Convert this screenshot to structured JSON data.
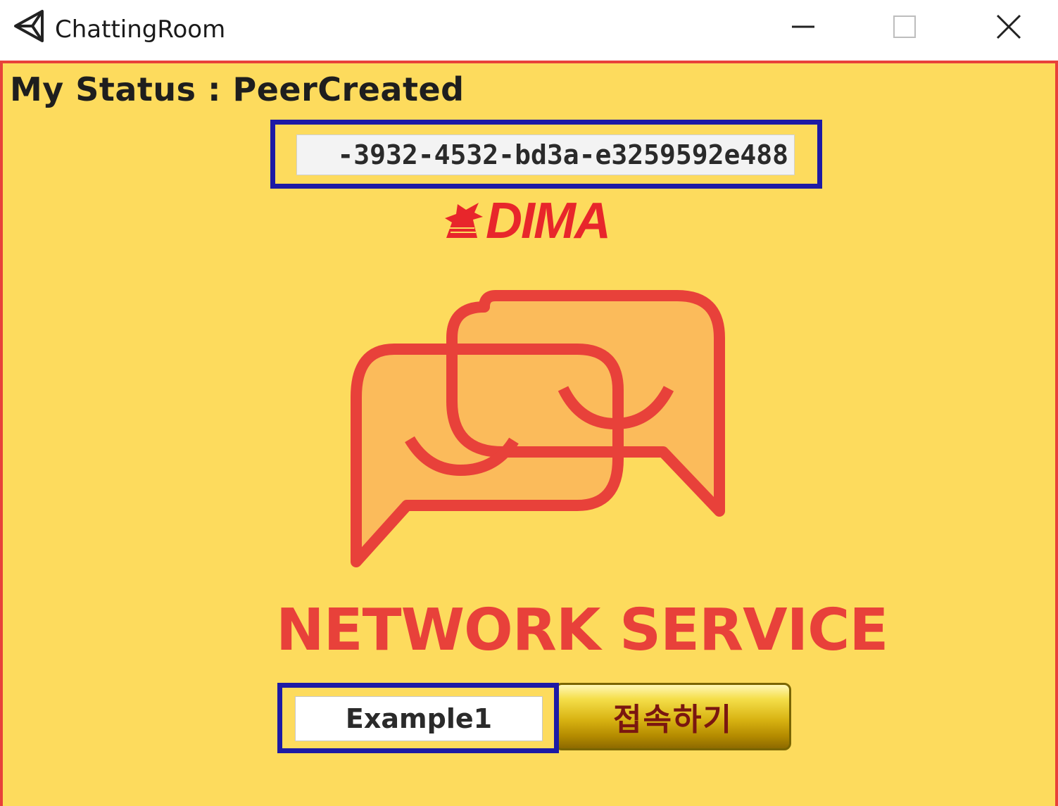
{
  "window": {
    "title": "ChattingRoom",
    "app_icon": "unity-logo-icon",
    "controls": [
      "minimize-icon",
      "maximize-icon",
      "close-icon"
    ]
  },
  "status": {
    "text": "My Status : PeerCreated"
  },
  "peer_id_field": {
    "value": "-3932-4532-bd3a-e3259592e488"
  },
  "logo": {
    "text": "DIMA",
    "icon": "dragon-head-icon"
  },
  "illustration": {
    "icon": "chat-bubbles-icon"
  },
  "service_title": "NETWORK SERVICE",
  "name_field": {
    "value": "Example1"
  },
  "connect_button": {
    "label": "접속하기"
  },
  "colors": {
    "background": "#fddb5d",
    "border": "#e8413a",
    "highlight_frame": "#1d1aa5",
    "logo": "#e8262b",
    "bubble_fill": "#fbbb5b",
    "button_gold": "#d8b312",
    "button_text": "#7a1610"
  }
}
